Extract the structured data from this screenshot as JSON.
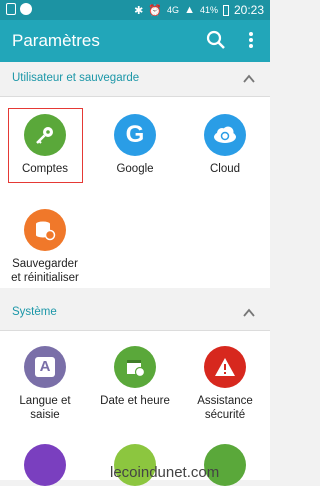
{
  "status_bar": {
    "network": "4G",
    "battery": "41%",
    "time": "20:23"
  },
  "app_bar": {
    "title": "Paramètres"
  },
  "sections": [
    {
      "title": "Utilisateur et sauvegarde"
    },
    {
      "title": "Système"
    }
  ],
  "tiles": {
    "comptes": {
      "label": "Comptes",
      "color": "#5aa83a",
      "icon": "key-icon"
    },
    "google": {
      "label": "Google",
      "color": "#2a9de6",
      "icon": "google-icon"
    },
    "cloud": {
      "label": "Cloud",
      "color": "#2a9de6",
      "icon": "cloud-sync-icon"
    },
    "sauvegarder": {
      "label": "Sauvegarder et réinitialiser",
      "color": "#f0782a",
      "icon": "backup-database-icon"
    },
    "langue": {
      "label": "Langue et saisie",
      "color": "#7a6fa8",
      "icon": "language-a-icon"
    },
    "date": {
      "label": "Date et heure",
      "color": "#5aa83a",
      "icon": "calendar-clock-icon"
    },
    "assistance": {
      "label": "Assistance sécurité",
      "color": "#d7281e",
      "icon": "warning-icon"
    }
  },
  "watermark": "lecoindunet.com"
}
